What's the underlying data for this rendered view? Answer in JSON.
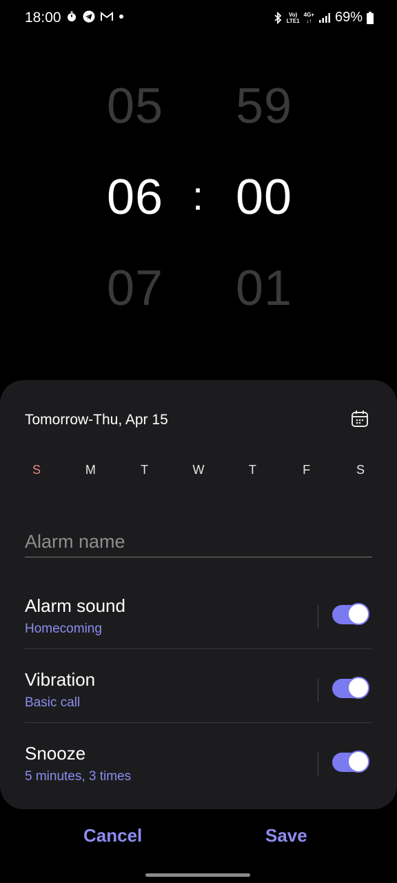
{
  "status_bar": {
    "time": "18:00",
    "network_top": "Vo)",
    "network_bottom": "LTE1",
    "signal_type_top": "4G+",
    "signal_type_bottom": "↓↑",
    "battery": "69%"
  },
  "picker": {
    "hours": {
      "prev": "05",
      "current": "06",
      "next": "07"
    },
    "minutes": {
      "prev": "59",
      "current": "00",
      "next": "01"
    },
    "separator": ":"
  },
  "sheet": {
    "date_label": "Tomorrow-Thu, Apr 15",
    "days": [
      "S",
      "M",
      "T",
      "W",
      "T",
      "F",
      "S"
    ],
    "alarm_name_placeholder": "Alarm name",
    "settings": [
      {
        "title": "Alarm sound",
        "subtitle": "Homecoming",
        "enabled": true
      },
      {
        "title": "Vibration",
        "subtitle": "Basic call",
        "enabled": true
      },
      {
        "title": "Snooze",
        "subtitle": "5 minutes, 3 times",
        "enabled": true
      }
    ]
  },
  "actions": {
    "cancel": "Cancel",
    "save": "Save"
  },
  "colors": {
    "accent": "#7c7af0",
    "accent_text": "#8d8cf0",
    "sunday": "#e88383",
    "sheet_bg": "#1c1c1e"
  }
}
